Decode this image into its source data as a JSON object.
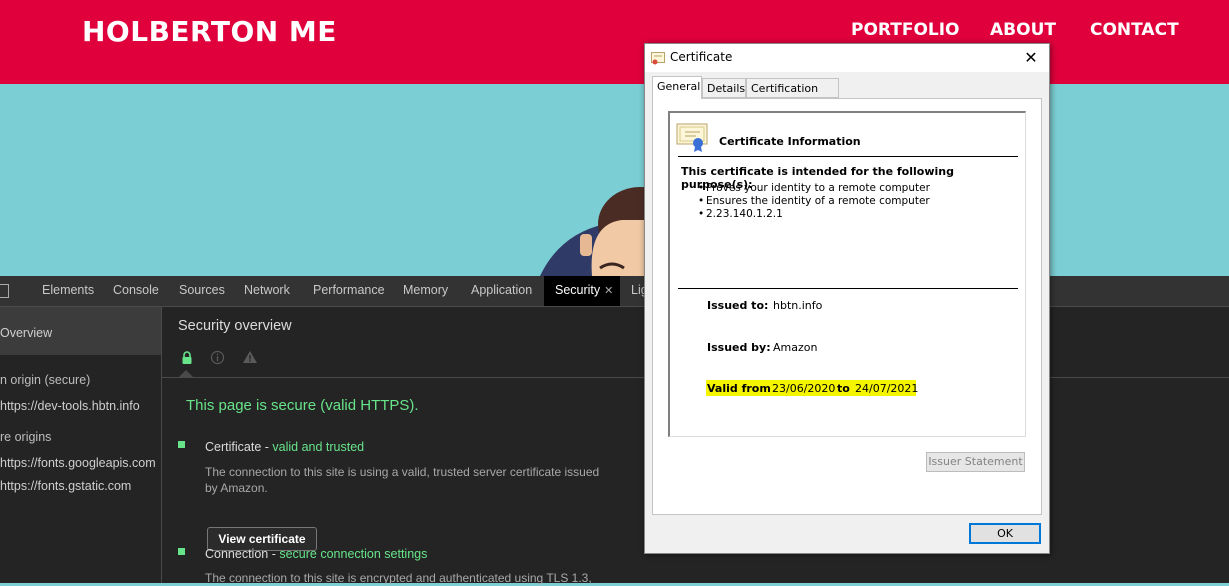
{
  "site": {
    "logo": "HOLBERTON ME",
    "nav": [
      "PORTFOLIO",
      "ABOUT",
      "CONTACT"
    ],
    "colors": {
      "header": "#e0003c",
      "hero": "#7bcfd4"
    }
  },
  "devtools": {
    "tabs": [
      "Elements",
      "Console",
      "Sources",
      "Network",
      "Performance",
      "Memory",
      "Application",
      "Security",
      "Lig"
    ],
    "active_tab": "Security",
    "sidebar": {
      "overview": "Overview",
      "main_origin_header": "n origin (secure)",
      "main_origin": "https://dev-tools.hbtn.info",
      "secure_origins_header": "re origins",
      "secure_origins": [
        "https://fonts.googleapis.com",
        "https://fonts.gstatic.com"
      ]
    },
    "security": {
      "title": "Security overview",
      "icons": [
        "lock-icon",
        "info-icon",
        "warning-icon"
      ],
      "secure_message": "This page is secure (valid HTTPS).",
      "certificate": {
        "title": "Certificate - ",
        "status": "valid and trusted",
        "desc": "The connection to this site is using a valid, trusted server certificate issued by Amazon.",
        "button": "View certificate"
      },
      "connection": {
        "title": "Connection - ",
        "status": "secure connection settings",
        "desc": "The connection to this site is encrypted and authenticated using TLS 1.3,"
      }
    }
  },
  "dialog": {
    "title": "Certificate",
    "close": "✕",
    "tabs": [
      "General",
      "Details",
      "Certification Path"
    ],
    "selected_tab": "General",
    "info_title": "Certificate Information",
    "purpose_heading": "This certificate is intended for the following purpose(s):",
    "purposes": [
      "Proves your identity to a remote computer",
      "Ensures the identity of a remote computer",
      "2.23.140.1.2.1"
    ],
    "issued_to_label": "Issued to:",
    "issued_to": "hbtn.info",
    "issued_by_label": "Issued by:",
    "issued_by": "Amazon",
    "valid_from_label": "Valid from",
    "valid_from": "23/06/2020",
    "to_label": "to",
    "valid_to": "24/07/2021",
    "issuer_statement": "Issuer Statement",
    "ok": "OK",
    "highlight_color": "#f5f500"
  }
}
